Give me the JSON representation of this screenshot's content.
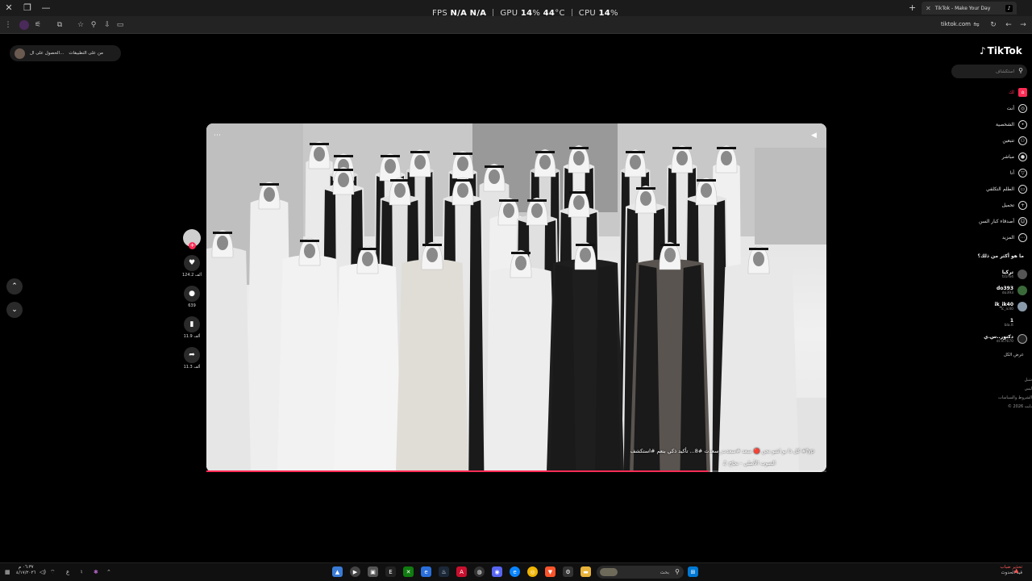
{
  "window": {
    "tab_title": "TikTok - Make Your Day",
    "url": "tiktok.com",
    "overlay": {
      "fps_label": "FPS",
      "fps_val1": "N/A",
      "fps_val2": "N/A",
      "gpu_label": "GPU",
      "gpu_val": "14",
      "gpu_unit": "%",
      "gpu_temp": "44",
      "gpu_temp_unit": "°C",
      "cpu_label": "CPU",
      "cpu_val": "14",
      "cpu_unit": "%"
    }
  },
  "pill": {
    "item1": "من على التطبيقات",
    "item2": "الحصول على ال..."
  },
  "sidebar": {
    "logo": "TikTok",
    "search_placeholder": "استكشاف",
    "nav": [
      {
        "label": "لك",
        "icon": "home-icon"
      },
      {
        "label": "أنت",
        "icon": "explore-icon"
      },
      {
        "label": "الشخصية",
        "icon": "profile-icon"
      },
      {
        "label": "تتبعين",
        "icon": "following-icon"
      },
      {
        "label": "مباشر",
        "icon": "live-icon"
      },
      {
        "label": "أنا",
        "icon": "inbox-icon"
      },
      {
        "label": "الطلم التكلفي",
        "icon": "messages-icon"
      },
      {
        "label": "تحميل",
        "icon": "upload-icon"
      },
      {
        "label": "أصدقاء كبار السن",
        "icon": "friends-icon"
      },
      {
        "label": "المزيد",
        "icon": "more-icon"
      }
    ],
    "following_title": "ما هو أكثر من ذلك؟",
    "following": [
      {
        "name": "تركيا",
        "user": "fz1r64"
      },
      {
        "name": "do393",
        "user": "do393"
      },
      {
        "name": "ik_ik40",
        "user": "ic_ic40"
      },
      {
        "name": "1",
        "user": "bla.lt"
      },
      {
        "name": "دكتور..س.ي",
        "user": "dr.el7670"
      }
    ],
    "see_all": "عرض الكل",
    "footer": [
      "شبل",
      "ليس",
      "الشروط والسياسات",
      "© 2026 بايت"
    ]
  },
  "video": {
    "caption": "كل ذا بو اشو نحن 🔴 سعد #سعدت_سعدت #8... تأكيد ذكي بنعم #استكشف #fyp",
    "sound": "♫ الصوت الأصلي - نجاح",
    "progress": 0.81
  },
  "actions": [
    {
      "icon": "heart-icon",
      "count": "124.2 ألف"
    },
    {
      "icon": "comment-icon",
      "count": "639"
    },
    {
      "icon": "bookmark-icon",
      "count": "11.9 ألف"
    },
    {
      "icon": "share-icon",
      "count": "11.3 ألف"
    }
  ],
  "taskbar": {
    "search_label": "بحث",
    "time": "٠٦:٣٧ م",
    "date": "٤/١٧/٢٠٢٦",
    "lang": "ع",
    "warning_line1": "تحذير ضباب",
    "warning_line2": "قيد الحدوث"
  }
}
